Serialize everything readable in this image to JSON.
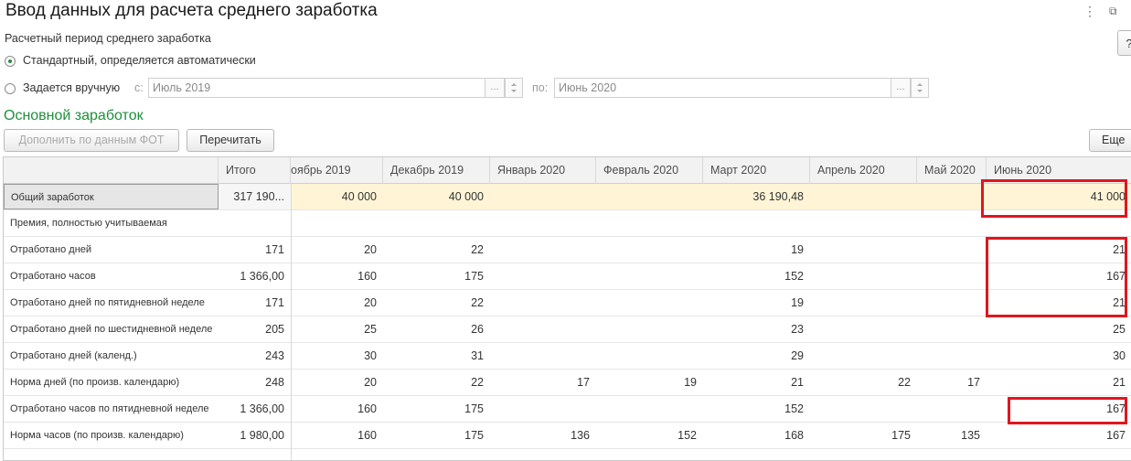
{
  "window": {
    "title": "Ввод данных для расчета среднего заработка",
    "menu_icon": "⋮",
    "restore_icon": "⧉",
    "help_label": "?"
  },
  "period": {
    "label": "Расчетный период среднего заработка",
    "option_auto": "Стандартный, определяется автоматически",
    "option_manual": "Задается вручную",
    "selected": "auto",
    "from_label": "с:",
    "from_value": "Июль 2019",
    "to_label": "по:",
    "to_value": "Июнь 2020",
    "select_btn": "..."
  },
  "section_title": "Основной заработок",
  "buttons": {
    "fill_fot": "Дополнить по данным ФОТ",
    "recalc": "Перечитать",
    "more": "Еще"
  },
  "table": {
    "headers": [
      "",
      "Итого",
      "оябрь 2019",
      "Декабрь 2019",
      "Январь 2020",
      "Февраль 2020",
      "Март 2020",
      "Апрель 2020",
      "Май 2020",
      "Июнь 2020"
    ],
    "rows": [
      {
        "label": "Общий заработок",
        "total": "317 190...",
        "values": [
          "40 000",
          "40 000",
          "",
          "",
          "36 190,48",
          "",
          "",
          "41 000"
        ]
      },
      {
        "label": "Премия, полностью учитываемая",
        "total": "",
        "values": [
          "",
          "",
          "",
          "",
          "",
          "",
          "",
          ""
        ]
      },
      {
        "label": "Отработано дней",
        "total": "171",
        "values": [
          "20",
          "22",
          "",
          "",
          "19",
          "",
          "",
          "21"
        ]
      },
      {
        "label": "Отработано часов",
        "total": "1 366,00",
        "values": [
          "160",
          "175",
          "",
          "",
          "152",
          "",
          "",
          "167"
        ]
      },
      {
        "label": "Отработано дней по пятидневной неделе",
        "total": "171",
        "values": [
          "20",
          "22",
          "",
          "",
          "19",
          "",
          "",
          "21"
        ]
      },
      {
        "label": "Отработано дней по шестидневной неделе",
        "total": "205",
        "values": [
          "25",
          "26",
          "",
          "",
          "23",
          "",
          "",
          "25"
        ]
      },
      {
        "label": "Отработано дней (календ.)",
        "total": "243",
        "values": [
          "30",
          "31",
          "",
          "",
          "29",
          "",
          "",
          "30"
        ]
      },
      {
        "label": "Норма дней (по произв. календарю)",
        "total": "248",
        "values": [
          "20",
          "22",
          "17",
          "19",
          "21",
          "22",
          "17",
          "21"
        ]
      },
      {
        "label": "Отработано часов по пятидневной неделе",
        "total": "1 366,00",
        "values": [
          "160",
          "175",
          "",
          "",
          "152",
          "",
          "",
          "167"
        ]
      },
      {
        "label": "Норма часов (по произв. календарю)",
        "total": "1 980,00",
        "values": [
          "160",
          "175",
          "136",
          "152",
          "168",
          "175",
          "135",
          "167"
        ]
      }
    ]
  },
  "colors": {
    "accent_green": "#1f8f3a",
    "highlight_row": "#fff5d6",
    "annotation_red": "#e0161e"
  }
}
